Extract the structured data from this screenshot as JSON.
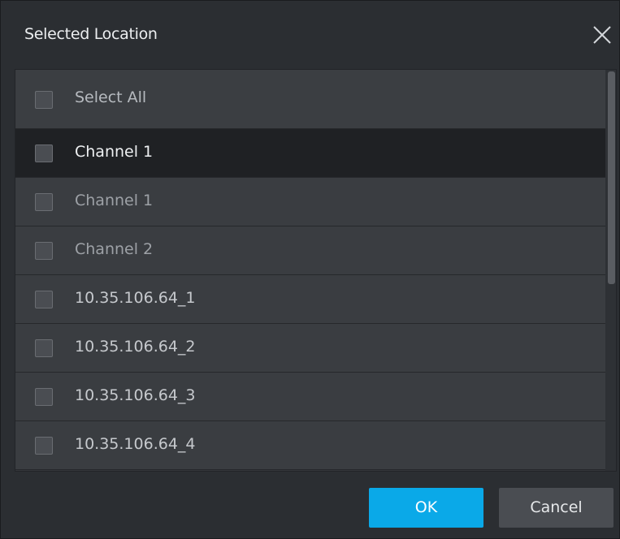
{
  "dialog": {
    "title": "Selected Location",
    "close_icon": "close-icon"
  },
  "list": {
    "select_all": {
      "label": "Select All",
      "checked": false
    },
    "items": [
      {
        "label": "Channel 1",
        "checked": false,
        "highlighted": true
      },
      {
        "label": "Channel 1",
        "checked": false
      },
      {
        "label": "Channel 2",
        "checked": false
      },
      {
        "label": "10.35.106.64_1",
        "checked": false
      },
      {
        "label": "10.35.106.64_2",
        "checked": false
      },
      {
        "label": "10.35.106.64_3",
        "checked": false
      },
      {
        "label": "10.35.106.64_4",
        "checked": false
      }
    ]
  },
  "buttons": {
    "ok_label": "OK",
    "cancel_label": "Cancel"
  },
  "colors": {
    "background": "#2b2e32",
    "accent": "#0aa9e8",
    "highlight_row": "#1f2124"
  }
}
